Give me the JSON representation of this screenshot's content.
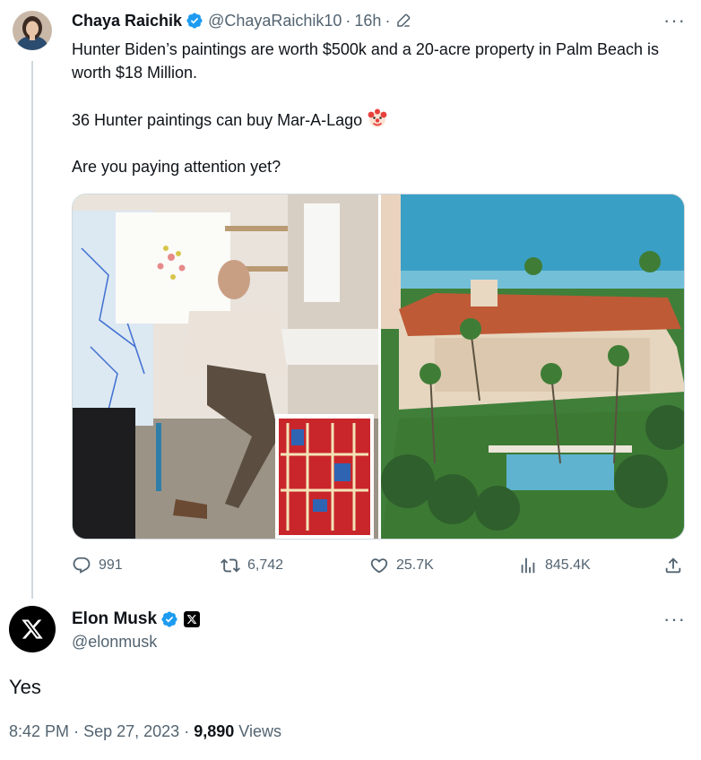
{
  "tweet": {
    "author_name": "Chaya Raichik",
    "handle": "@ChayaRaichik10",
    "separator": "·",
    "time": "16h",
    "text": "Hunter Biden’s paintings are worth $500k and a 20-acre property in Palm Beach is worth $18 Million.\n\n36 Hunter paintings can buy Mar-A-Lago",
    "text_2": "Are you paying attention yet?",
    "more": "···",
    "stats": {
      "replies": "991",
      "reposts": "6,742",
      "likes": "25.7K",
      "views": "845.4K"
    }
  },
  "reply": {
    "author_name": "Elon Musk",
    "handle": "@elonmusk",
    "more": "···",
    "text": "Yes",
    "time": "8:42 PM",
    "separator": "·",
    "date": "Sep 27, 2023",
    "views_count": "9,890",
    "views_label": "Views"
  },
  "colors": {
    "verified_blue": "#1d9bf0",
    "secondary_text": "#536471",
    "thread_line": "#cfd9de"
  },
  "icons": [
    "verified-badge-icon",
    "edit-pencil-icon",
    "more-icon",
    "reply-icon",
    "repost-icon",
    "like-icon",
    "views-icon",
    "share-icon",
    "x-logo-icon",
    "clown-emoji-icon"
  ]
}
